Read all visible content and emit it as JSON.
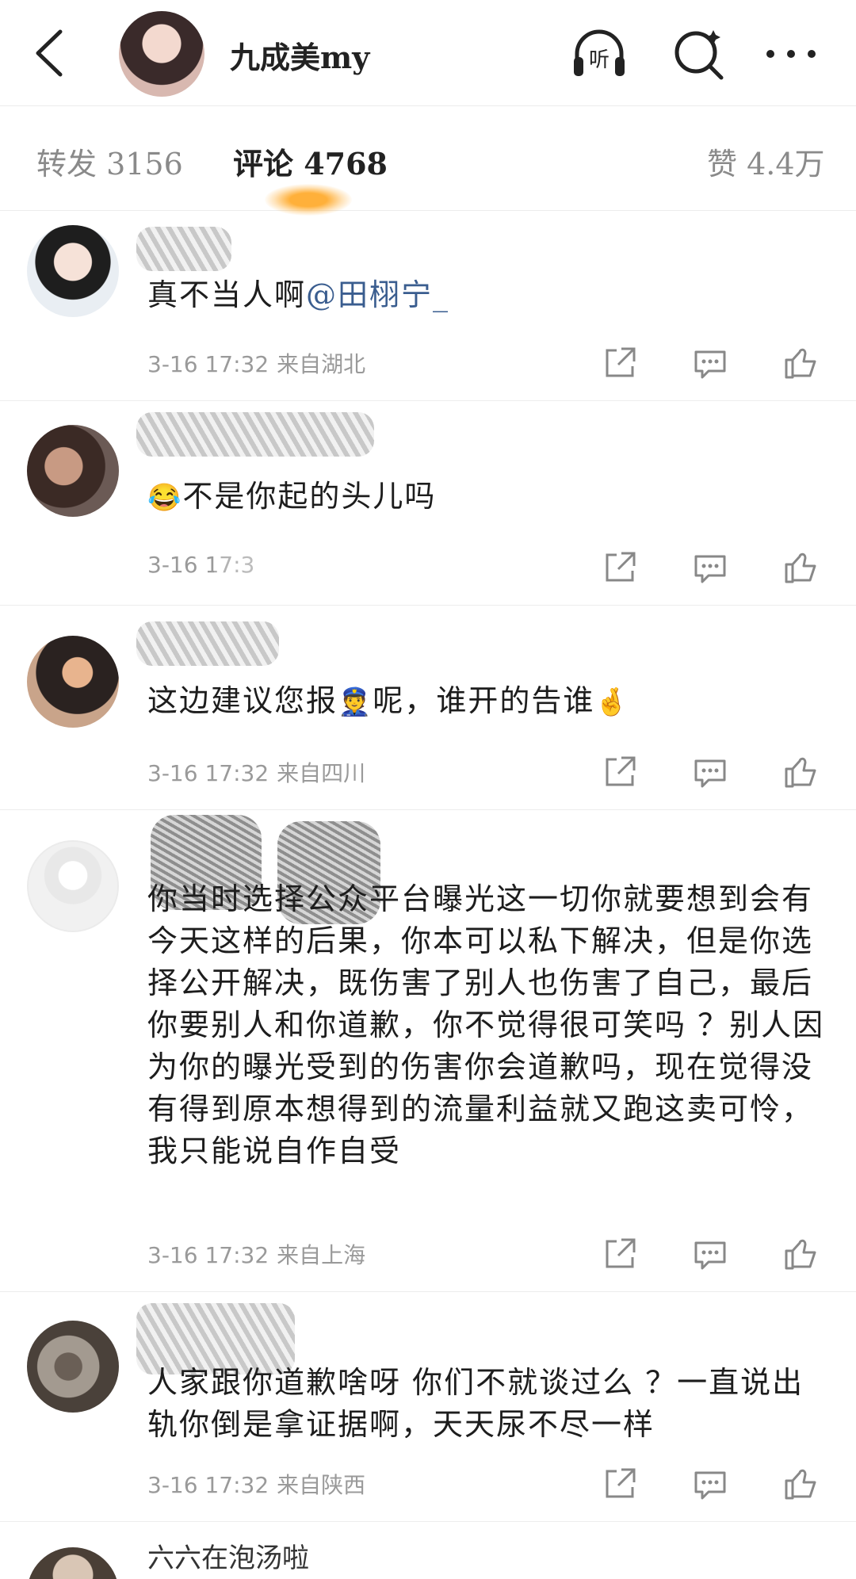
{
  "header": {
    "username": "九成美my",
    "icons": [
      "back-icon",
      "listen-icon",
      "search-icon",
      "more-icon"
    ],
    "listen_label": "听"
  },
  "tabs": {
    "reposts": "转发 3156",
    "comments": "评论 4768",
    "likes": "赞 4.4万"
  },
  "accent_color": "#ffb03a",
  "mention_color": "#3a5d8f",
  "comments": [
    {
      "text_before": "真不当人啊",
      "mention": "@田栩宁_",
      "date": "3-16 17:32",
      "location": "来自湖北"
    },
    {
      "emoji": "😂",
      "text": "不是你起的头儿吗",
      "date": "3-16 17:3",
      "location": ""
    },
    {
      "text_part1": "这边建议您报",
      "emoji1": "👮",
      "text_part2": "呢，谁开的告谁",
      "emoji2": "🤞",
      "date": "3-16 17:32",
      "location": "来自四川"
    },
    {
      "text": "你当时选择公众平台曝光这一切你就要想到会有今天这样的后果，你本可以私下解决，但是你选择公开解决，既伤害了别人也伤害了自己，最后你要别人和你道歉，你不觉得很可笑吗 ？别人因为你的曝光受到的伤害你会道歉吗，现在觉得没有得到原本想得到的流量利益就又跑这卖可怜，我只能说自作自受",
      "date": "3-16 17:32",
      "location": "来自上海"
    },
    {
      "text": "人家跟你道歉啥呀 你们不就谈过么 ？一直说出轨你倒是拿证据啊，天天尿不尽一样",
      "date": "3-16 17:32",
      "location": "来自陕西"
    },
    {
      "name": "六六在泡汤啦"
    }
  ]
}
